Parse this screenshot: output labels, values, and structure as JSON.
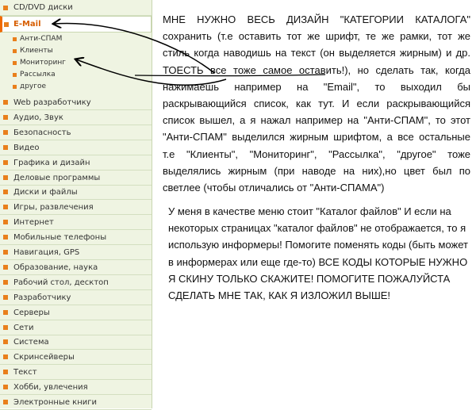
{
  "menu": {
    "top_item": "CD/DVD диски",
    "active_item": "E-Mail",
    "sub_items": [
      "Анти-СПАМ",
      "Клиенты",
      "Мониторинг",
      "Рассылка",
      "другое"
    ],
    "items": [
      "Web разработчику",
      "Аудио, Звук",
      "Безопасность",
      "Видео",
      "Графика и дизайн",
      "Деловые программы",
      "Диски и файлы",
      "Игры, развлечения",
      "Интернет",
      "Мобильные телефоны",
      "Навигация, GPS",
      "Образование, наука",
      "Рабочий стол, десктоп",
      "Разработчику",
      "Серверы",
      "Сети",
      "Система",
      "Скринсейверы",
      "Текст",
      "Хобби, увлечения",
      "Электронные книги"
    ]
  },
  "note": {
    "paragraph1": "МНЕ НУЖНО ВЕСЬ ДИЗАЙН \"КАТЕГОРИИ КАТАЛОГА\" сохранить (т.е оставить тот же шрифт, те же рамки, тот же стиль когда наводишь на текст (он выделяется жирным) и др. ТОЕСТЬ все тоже самое оставить!), но сделать так, когда нажимаешь например на \"Email\", то выходил бы раскрывающийся список, как тут. И если раскрывающийся список вышел, а я нажал например на \"Анти-СПАМ\", то этот \"Анти-СПАМ\" выделился жирным шрифтом, а все остальные т.е \"Клиенты\", \"Мониторинг\", \"Рассылка\", \"другое\" тоже выделялись жирным (при наводе на них),но цвет был по светлее (чтобы отличались от \"Анти-СПАМА\")",
    "paragraph2": "У меня в качестве меню стоит \"Каталог файлов\" И если на некоторых страницах \"каталог файлов\" не отображается, то я использую информеры! Помогите поменять коды (быть может в информерах или еще где-то) ВСЕ КОДЫ КОТОРЫЕ НУЖНО Я СКИНУ ТОЛЬКО СКАЖИТЕ! ПОМОГИТЕ ПОЖАЛУЙСТА СДЕЛАТЬ МНЕ ТАК, КАК Я ИЗЛОЖИЛ ВЫШЕ!"
  },
  "colors": {
    "menu_bg": "#eff4e2",
    "accent": "#f06a00",
    "bullet": "#e97f1c",
    "arrow": "#000000"
  }
}
